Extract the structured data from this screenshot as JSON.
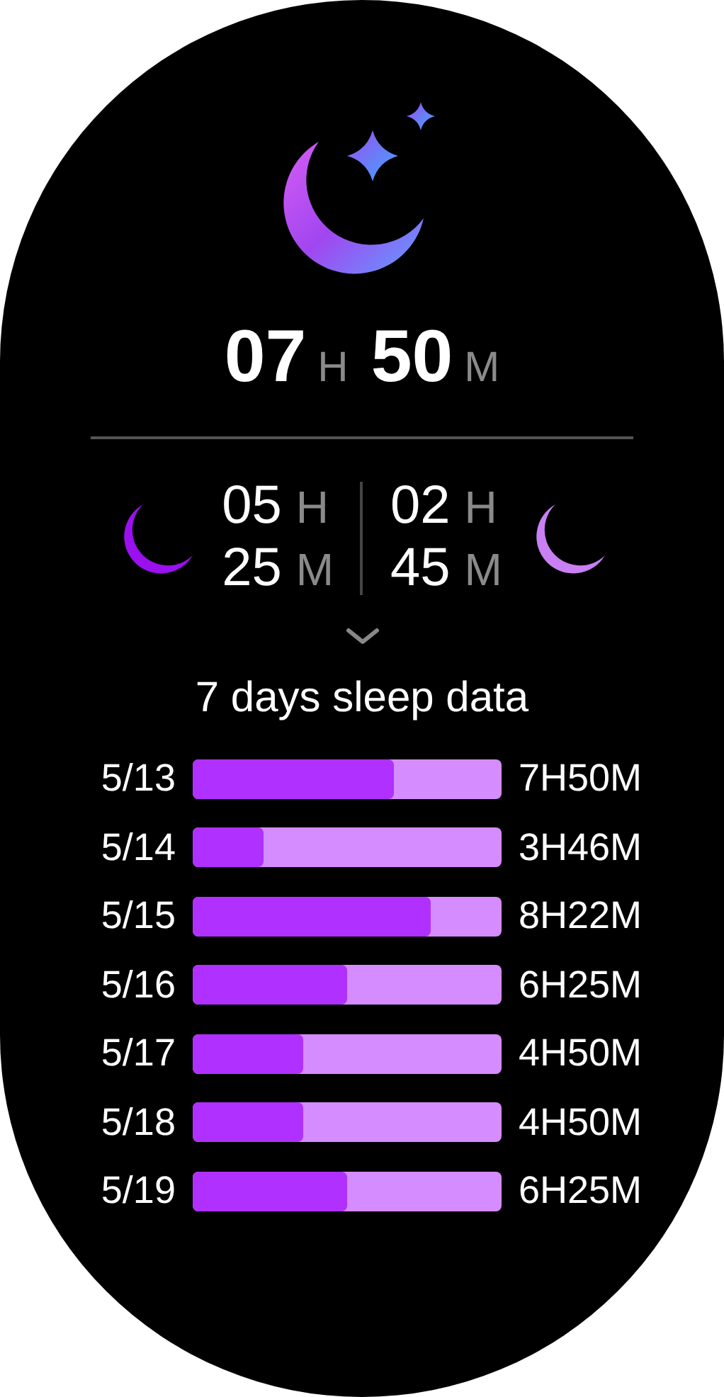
{
  "total": {
    "hours": "07",
    "hours_unit": "H",
    "minutes": "50",
    "minutes_unit": "M"
  },
  "stages": [
    {
      "hours": "05",
      "hours_unit": "H",
      "minutes": "25",
      "minutes_unit": "M",
      "color": "#9a10ef"
    },
    {
      "hours": "02",
      "hours_unit": "H",
      "minutes": "45",
      "minutes_unit": "M",
      "color": "#c880f3"
    }
  ],
  "history": {
    "title": "7 days sleep data",
    "rows": [
      {
        "date": "5/13",
        "level": 0.65,
        "duration": "7H50M"
      },
      {
        "date": "5/14",
        "level": 0.23,
        "duration": "3H46M"
      },
      {
        "date": "5/15",
        "level": 0.77,
        "duration": "8H22M"
      },
      {
        "date": "5/16",
        "level": 0.5,
        "duration": "6H25M"
      },
      {
        "date": "5/17",
        "level": 0.36,
        "duration": "4H50M"
      },
      {
        "date": "5/18",
        "level": 0.36,
        "duration": "4H50M"
      },
      {
        "date": "5/19",
        "level": 0.5,
        "duration": "6H25M"
      }
    ]
  }
}
